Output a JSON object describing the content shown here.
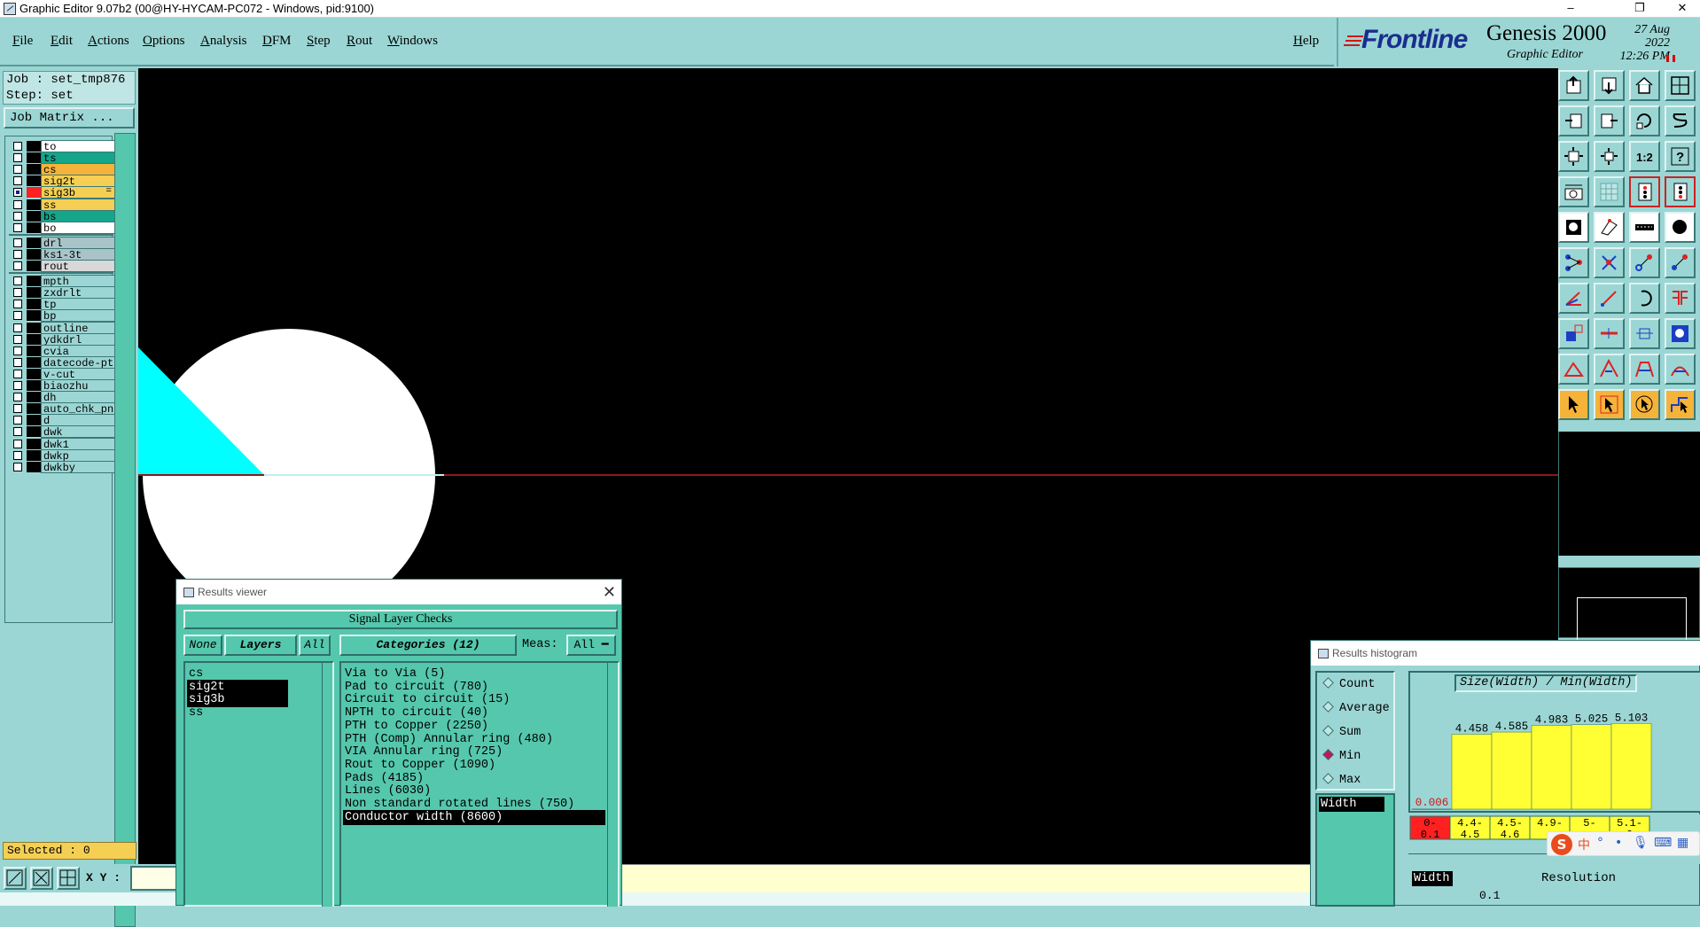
{
  "titlebar": {
    "title": "Graphic Editor 9.07b2 (00@HY-HYCAM-PC072 - Windows, pid:9100)",
    "minimize": "–",
    "restore": "❐",
    "close": "✕"
  },
  "menu": {
    "items": [
      "File",
      "Edit",
      "Actions",
      "Options",
      "Analysis",
      "DFM",
      "Step",
      "Rout",
      "Windows"
    ],
    "help": "Help"
  },
  "logo": {
    "brand": "Frontline",
    "product": "Genesis 2000",
    "subtitle": "Graphic Editor",
    "date": "27 Aug 2022",
    "time": "12:26 PM"
  },
  "job": {
    "job_label": "Job : set_tmp876",
    "step_label": "Step: set",
    "matrix_button": "Job Matrix ...",
    "selected": "Selected : 0"
  },
  "colors": {
    "panel": "#9bd6d4",
    "dialog": "#55c7ac",
    "highlight_yellow": "#f5cf54",
    "canvas": "#000000",
    "trace_red": "#8b1a1a",
    "cyan_fill": "#00ffff"
  },
  "layers": [
    {
      "name": "to",
      "color": "#ffffff",
      "swatch": "#000000",
      "on": false
    },
    {
      "name": "ts",
      "color": "#14a58a",
      "swatch": "#000000",
      "on": false
    },
    {
      "name": "cs",
      "color": "#f5b33a",
      "swatch": "#000000",
      "on": false
    },
    {
      "name": "sig2t",
      "color": "#f5cf54",
      "swatch": "#000000",
      "on": false
    },
    {
      "name": "sig3b",
      "color": "#f5cf54",
      "swatch": "#ff2020",
      "on": true,
      "marker": "="
    },
    {
      "name": "ss",
      "color": "#f5cf54",
      "swatch": "#000000",
      "on": false
    },
    {
      "name": "bs",
      "color": "#14a58a",
      "swatch": "#000000",
      "on": false
    },
    {
      "name": "bo",
      "color": "#ffffff",
      "swatch": "#000000",
      "on": false
    },
    {
      "name": "drl",
      "color": "#a8c4c8",
      "swatch": "#000000",
      "on": false
    },
    {
      "name": "ks1-3t",
      "color": "#a8c4c8",
      "swatch": "#000000",
      "on": false
    },
    {
      "name": "rout",
      "color": "#d8d8d8",
      "swatch": "#000000",
      "on": false
    },
    {
      "name": "mpth",
      "color": "#9bd6d4",
      "swatch": "#000000",
      "on": false
    },
    {
      "name": "zxdrlt",
      "color": "#9bd6d4",
      "swatch": "#000000",
      "on": false
    },
    {
      "name": "tp",
      "color": "#9bd6d4",
      "swatch": "#000000",
      "on": false
    },
    {
      "name": "bp",
      "color": "#9bd6d4",
      "swatch": "#000000",
      "on": false
    },
    {
      "name": "outline",
      "color": "#9bd6d4",
      "swatch": "#000000",
      "on": false
    },
    {
      "name": "ydkdrl",
      "color": "#9bd6d4",
      "swatch": "#000000",
      "on": false
    },
    {
      "name": "cvia",
      "color": "#9bd6d4",
      "swatch": "#000000",
      "on": false
    },
    {
      "name": "datecode-pt",
      "color": "#9bd6d4",
      "swatch": "#000000",
      "on": false
    },
    {
      "name": "v-cut",
      "color": "#9bd6d4",
      "swatch": "#000000",
      "on": false
    },
    {
      "name": "biaozhu",
      "color": "#9bd6d4",
      "swatch": "#000000",
      "on": false
    },
    {
      "name": "dh",
      "color": "#9bd6d4",
      "swatch": "#000000",
      "on": false
    },
    {
      "name": "auto_chk_pn",
      "color": "#9bd6d4",
      "swatch": "#000000",
      "on": false
    },
    {
      "name": "d",
      "color": "#9bd6d4",
      "swatch": "#000000",
      "on": false
    },
    {
      "name": "dwk",
      "color": "#9bd6d4",
      "swatch": "#000000",
      "on": false
    },
    {
      "name": "dwk1",
      "color": "#9bd6d4",
      "swatch": "#000000",
      "on": false
    },
    {
      "name": "dwkp",
      "color": "#9bd6d4",
      "swatch": "#000000",
      "on": false
    },
    {
      "name": "dwkby",
      "color": "#9bd6d4",
      "swatch": "#000000",
      "on": false
    }
  ],
  "status": {
    "xy_label": "X Y :"
  },
  "results_viewer": {
    "title": "Results viewer",
    "close": "✕",
    "header": "Signal Layer Checks",
    "none_button": "None",
    "layers_button": "Layers",
    "all_button": "All",
    "categories_button": "Categories (12)",
    "meas_label": "Meas:",
    "meas_value": "All",
    "layers": [
      {
        "name": "cs",
        "selected": false
      },
      {
        "name": "sig2t",
        "selected": true
      },
      {
        "name": "sig3b",
        "selected": true
      },
      {
        "name": "ss",
        "selected": false
      }
    ],
    "categories": [
      {
        "name": "Via to Via (5)",
        "selected": false
      },
      {
        "name": "Pad to circuit (780)",
        "selected": false
      },
      {
        "name": "Circuit to circuit (15)",
        "selected": false
      },
      {
        "name": "NPTH to circuit (40)",
        "selected": false
      },
      {
        "name": "PTH to Copper (2250)",
        "selected": false
      },
      {
        "name": "PTH (Comp) Annular ring (480)",
        "selected": false
      },
      {
        "name": "VIA Annular ring (725)",
        "selected": false
      },
      {
        "name": "Rout to Copper (1090)",
        "selected": false
      },
      {
        "name": "Pads (4185)",
        "selected": false
      },
      {
        "name": "Lines (6030)",
        "selected": false
      },
      {
        "name": "Non standard rotated lines (750)",
        "selected": false
      },
      {
        "name": "Conductor width (8600)",
        "selected": true
      }
    ]
  },
  "results_histogram": {
    "title": "Results histogram",
    "options": [
      {
        "label": "Count",
        "on": false
      },
      {
        "label": "Average",
        "on": false
      },
      {
        "label": "Sum",
        "on": false
      },
      {
        "label": "Min",
        "on": true
      },
      {
        "label": "Max",
        "on": false
      }
    ],
    "measure": "Width",
    "resolution_label": "Resolution",
    "resolution_value": "0.1",
    "width_tag": "Width"
  },
  "chart_data": {
    "type": "bar",
    "title": "Size(Width) / Min(Width)",
    "categories": [
      "0-0.1",
      "4.4-4.5",
      "4.5-4.6",
      "4.9-",
      "5-",
      "5.1-5.2"
    ],
    "category_labels_top": [
      "0-",
      "4.4-",
      "4.5-",
      "4.9-",
      "5-",
      "5.1-"
    ],
    "category_labels_bottom": [
      "0.1",
      "4.5",
      "4.6",
      "",
      "",
      "2"
    ],
    "values": [
      0.006,
      4.458,
      4.585,
      4.983,
      5.025,
      5.103
    ],
    "value_labels": [
      "0.006",
      "4.458",
      "4.585",
      "4.983",
      "5.025",
      "5.103"
    ],
    "bar_colors": [
      "#ff2020",
      "#ffff33",
      "#ffff33",
      "#ffff33",
      "#ffff33",
      "#ffff33"
    ],
    "ylim": [
      0,
      5.2
    ]
  },
  "ime": {
    "logo": "S",
    "lang": "中",
    "glyphs": [
      "°",
      "•",
      "🎙",
      "⌨",
      "▦"
    ]
  }
}
